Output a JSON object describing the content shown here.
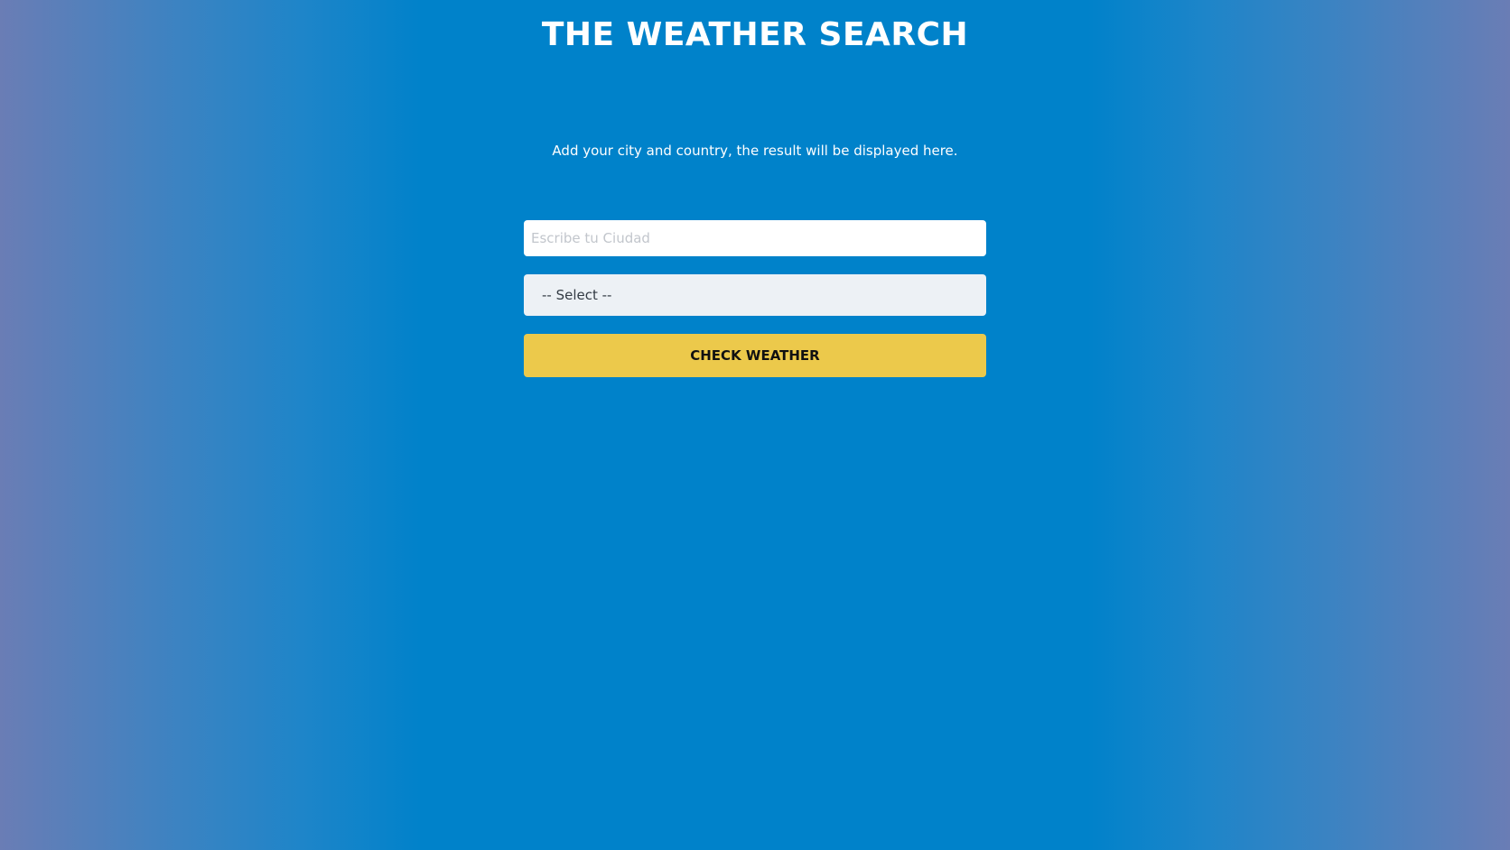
{
  "header": {
    "title": "THE WEATHER SEARCH"
  },
  "main": {
    "subtitle": "Add your city and country, the result will be displayed here."
  },
  "form": {
    "city_placeholder": "Escribe tu Ciudad",
    "city_value": "",
    "country_selected": "-- Select --",
    "submit_label": "CHECK WEATHER"
  },
  "colors": {
    "background_center": "#0082ca",
    "background_edge": "#6a7db5",
    "button": "#ecc94b",
    "select_bg": "#edf1f5",
    "text": "#ffffff"
  }
}
